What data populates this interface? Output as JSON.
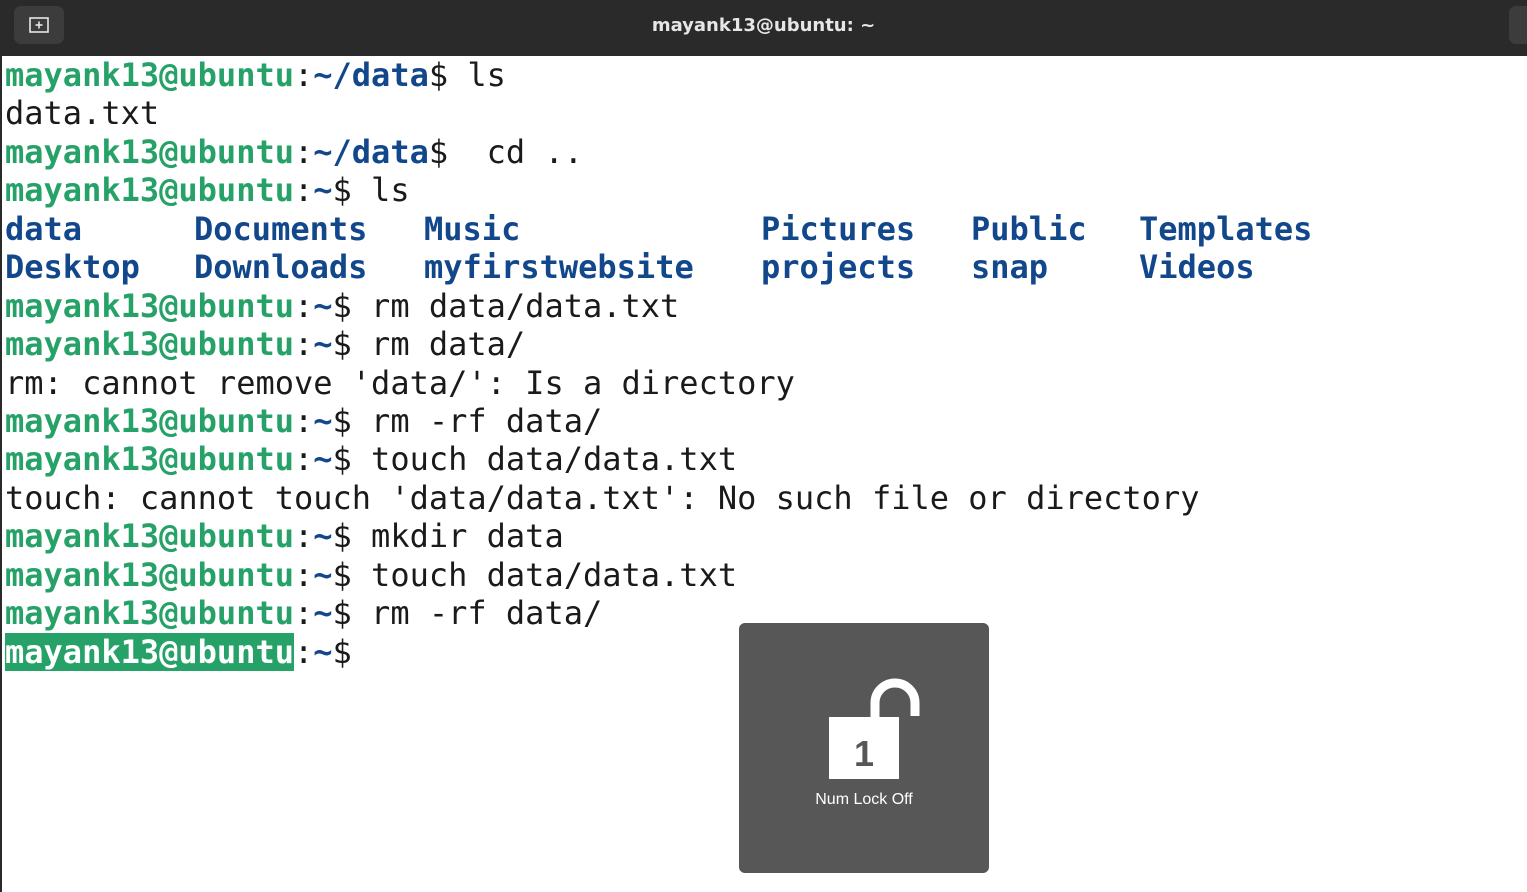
{
  "window": {
    "title": "mayank13@ubuntu: ~"
  },
  "prompt": {
    "user": "mayank13@ubuntu",
    "sep": ":"
  },
  "lines": [
    {
      "path": "~/data",
      "cmd": "$ ls"
    },
    {
      "output": "data.txt"
    },
    {
      "path": "~/data",
      "cmd": "$  cd .."
    },
    {
      "path": "~",
      "cmd": "$ ls"
    },
    {
      "path": "~",
      "cmd": "$ rm data/data.txt"
    },
    {
      "path": "~",
      "cmd": "$ rm data/"
    },
    {
      "output": "rm: cannot remove 'data/': Is a directory"
    },
    {
      "path": "~",
      "cmd": "$ rm -rf data/"
    },
    {
      "path": "~",
      "cmd": "$ touch data/data.txt"
    },
    {
      "output": "touch: cannot touch 'data/data.txt': No such file or directory"
    },
    {
      "path": "~",
      "cmd": "$ mkdir data"
    },
    {
      "path": "~",
      "cmd": "$ touch data/data.txt"
    },
    {
      "path": "~",
      "cmd": "$ rm -rf data/"
    },
    {
      "path": "~",
      "cmd": "$"
    }
  ],
  "ls_output": {
    "row1": [
      "data",
      "Documents",
      "Music",
      "Pictures",
      "Public",
      "Templates"
    ],
    "row2": [
      "Desktop",
      "Downloads",
      "myfirstwebsite",
      "projects",
      "snap",
      "Videos"
    ]
  },
  "osd": {
    "icon": "padlock-unlocked-icon",
    "digit": "1",
    "label": "Num Lock Off"
  },
  "colors": {
    "titlebar": "#2a2a2a",
    "prompt_user": "#26a269",
    "path_and_dirs": "#12488b",
    "text": "#1a1a1a",
    "osd_background": "#575757"
  }
}
